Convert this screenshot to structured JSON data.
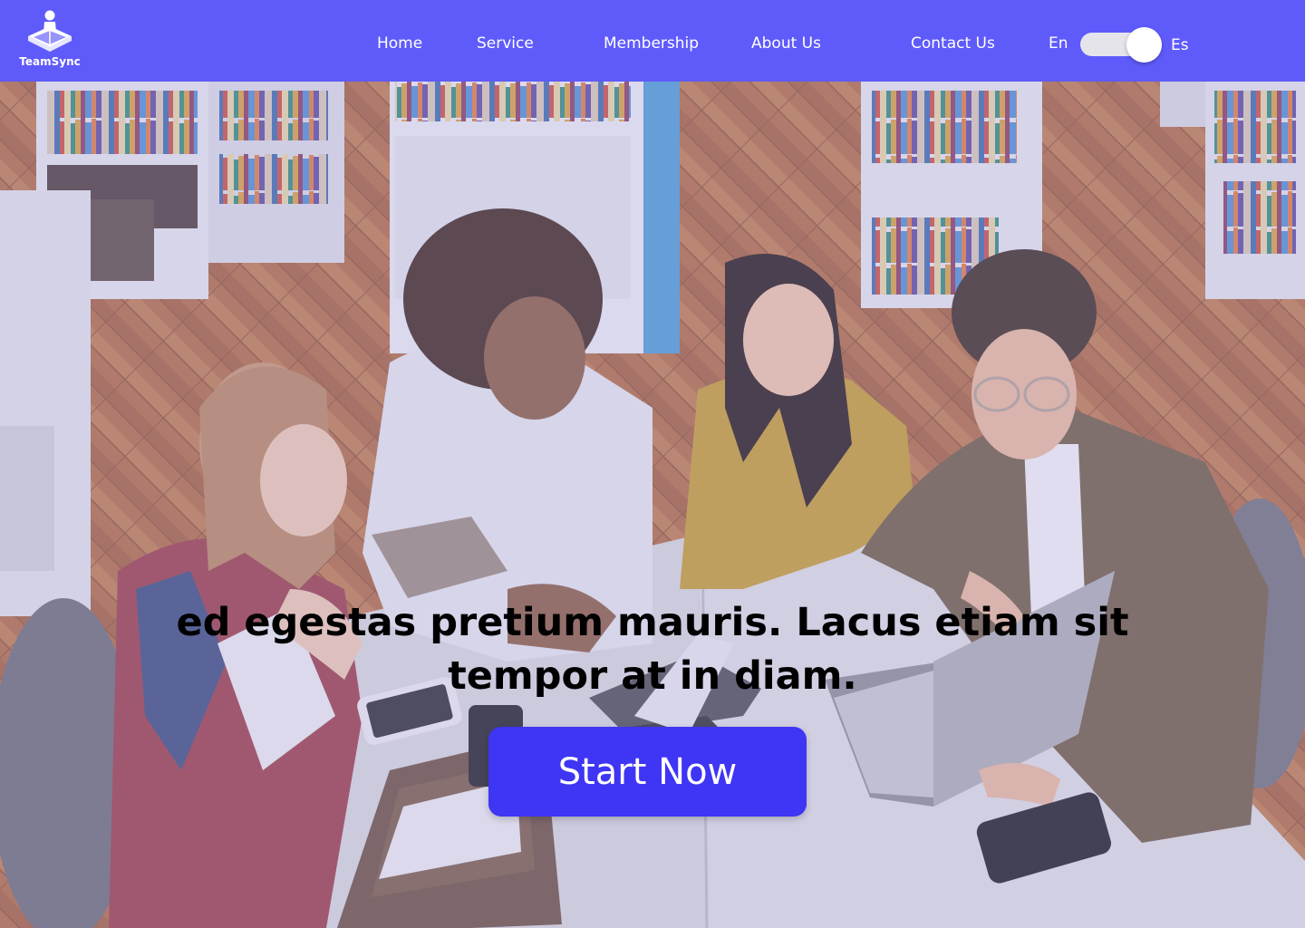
{
  "brand": {
    "name": "TeamSync",
    "logo_icon": "person-reading-book-icon"
  },
  "nav": {
    "items": [
      {
        "label": "Home"
      },
      {
        "label": "Service"
      },
      {
        "label": "Membership"
      },
      {
        "label": "About Us"
      },
      {
        "label": "Contact Us"
      }
    ]
  },
  "language": {
    "left_label": "En",
    "right_label": "Es",
    "selected": "Es"
  },
  "hero": {
    "image": "students-studying-in-library-photo",
    "heading": "ed egestas pretium mauris. Lacus etiam sit tempor at in diam.",
    "cta_label": "Start Now"
  },
  "colors": {
    "nav_bg": "#5f5bfb",
    "cta_bg": "#3f35f4",
    "text_light": "#ffffff",
    "heading": "#000000"
  }
}
